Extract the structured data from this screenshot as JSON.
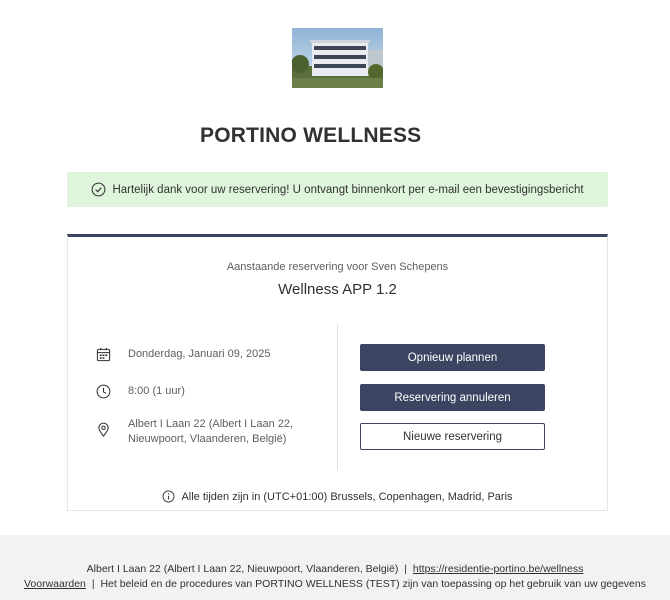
{
  "header": {
    "title": "PORTINO WELLNESS"
  },
  "banner": {
    "message": "Hartelijk dank voor uw reservering! U ontvangt binnenkort per e-mail een bevestigingsbericht"
  },
  "booking": {
    "subtitle": "Aanstaande reservering voor Sven Schepens",
    "service": "Wellness APP 1.2",
    "date": "Donderdag, Januari 09, 2025",
    "time": "8:00 (1 uur)",
    "location_line1": "Albert I Laan 22 (Albert I Laan 22,",
    "location_line2": "Nieuwpoort, Vlaanderen, België)",
    "timezone": "Alle tijden zijn in (UTC+01:00) Brussels, Copenhagen, Madrid, Paris"
  },
  "actions": {
    "reschedule": "Opnieuw plannen",
    "cancel": "Reservering annuleren",
    "new": "Nieuwe reservering"
  },
  "footer": {
    "address": "Albert I Laan 22 (Albert I Laan 22, Nieuwpoort, Vlaanderen, België)",
    "separator": "|",
    "website": "https://residentie-portino.be/wellness",
    "terms_link": "Voorwaarden",
    "policy_text": "Het beleid en de procedures van PORTINO WELLNESS (TEST) zijn van toepassing op het gebruik van uw gegevens"
  },
  "icons": {
    "banner": "check-circle-icon",
    "date": "calendar-icon",
    "time": "clock-icon",
    "location": "location-pin-icon",
    "timezone": "info-icon"
  },
  "colors": {
    "accent": "#3b4460",
    "success_bg": "#dff6dd",
    "footer_bg": "#f3f2f1"
  }
}
